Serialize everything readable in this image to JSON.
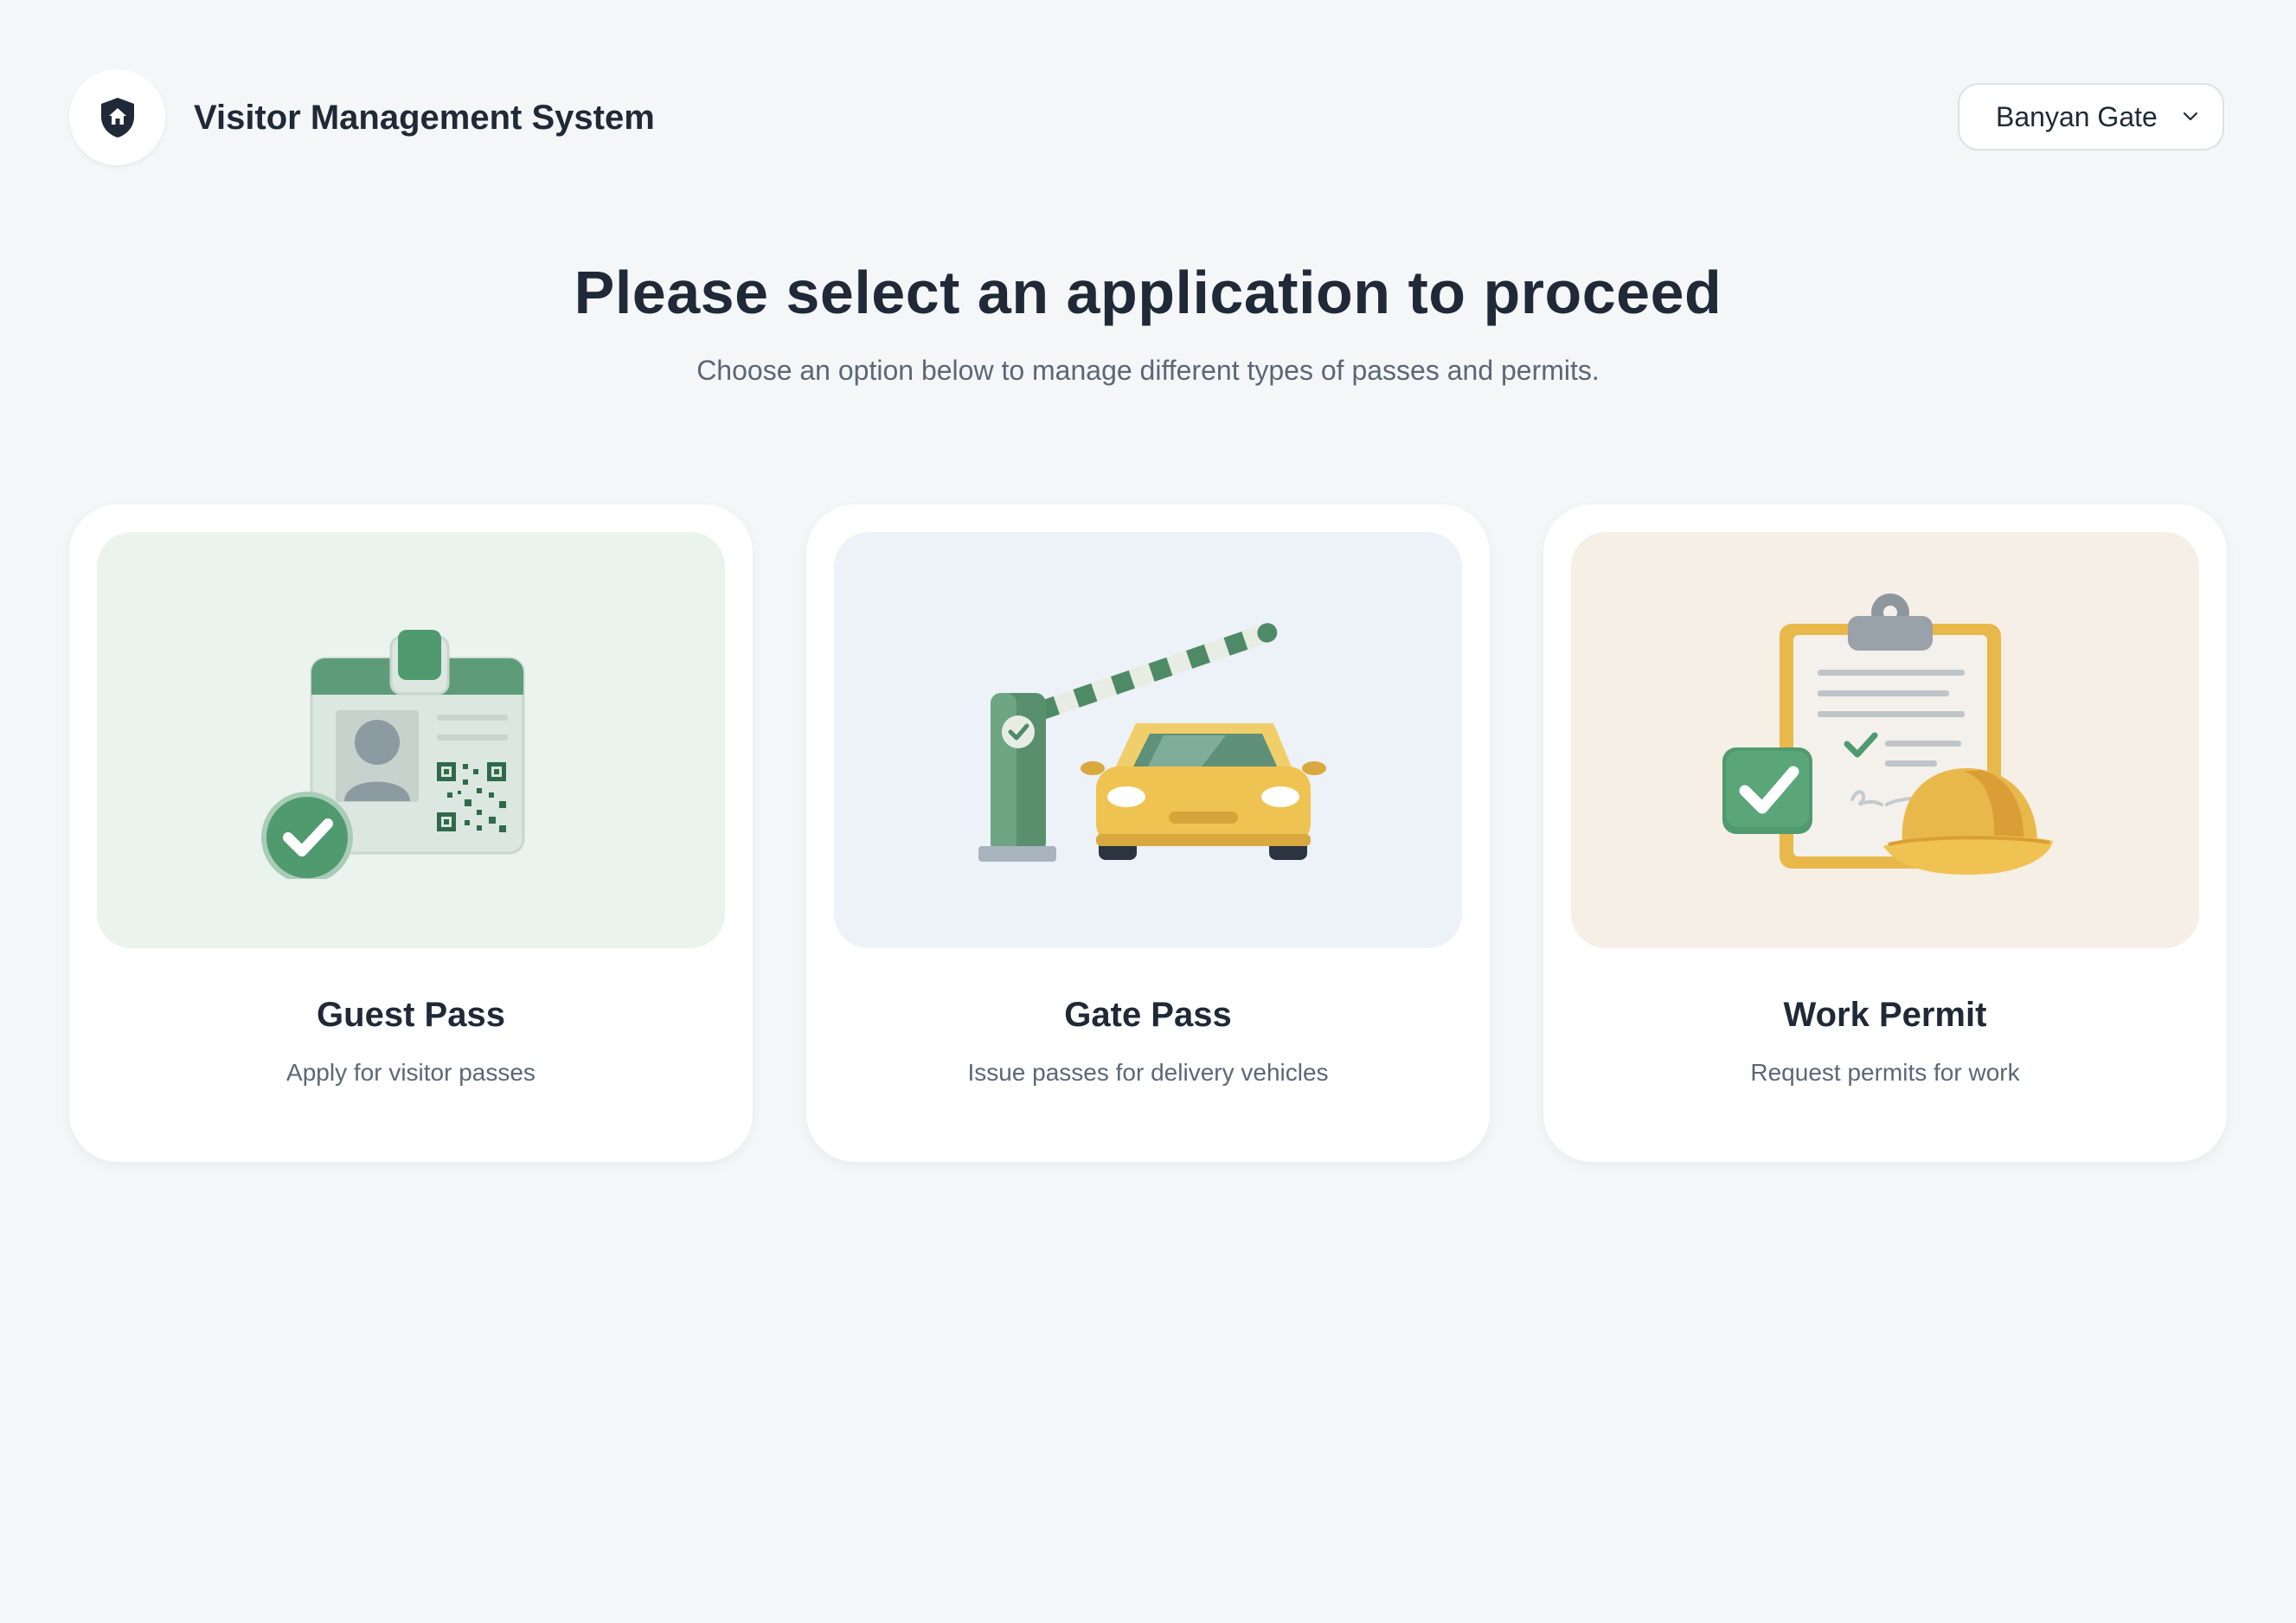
{
  "header": {
    "app_title": "Visitor Management System",
    "logo_icon": "shield-home-icon",
    "location_selected": "Banyan Gate"
  },
  "main": {
    "heading": "Please select an application to proceed",
    "subheading": "Choose an option below to manage different types of passes and permits."
  },
  "cards": [
    {
      "title": "Guest Pass",
      "description": "Apply for visitor passes",
      "icon": "id-badge-icon",
      "bg": "#eaf3ee"
    },
    {
      "title": "Gate Pass",
      "description": "Issue passes for delivery vehicles",
      "icon": "gate-barrier-car-icon",
      "bg": "#edf1f8"
    },
    {
      "title": "Work Permit",
      "description": "Request permits for work",
      "icon": "clipboard-hardhat-icon",
      "bg": "#f6efe6"
    }
  ],
  "colors": {
    "background": "#f4f6f8",
    "text_primary": "#1f2937",
    "text_secondary": "#5b6775",
    "accent_green": "#4f9a6e",
    "accent_yellow": "#e9b84a"
  }
}
